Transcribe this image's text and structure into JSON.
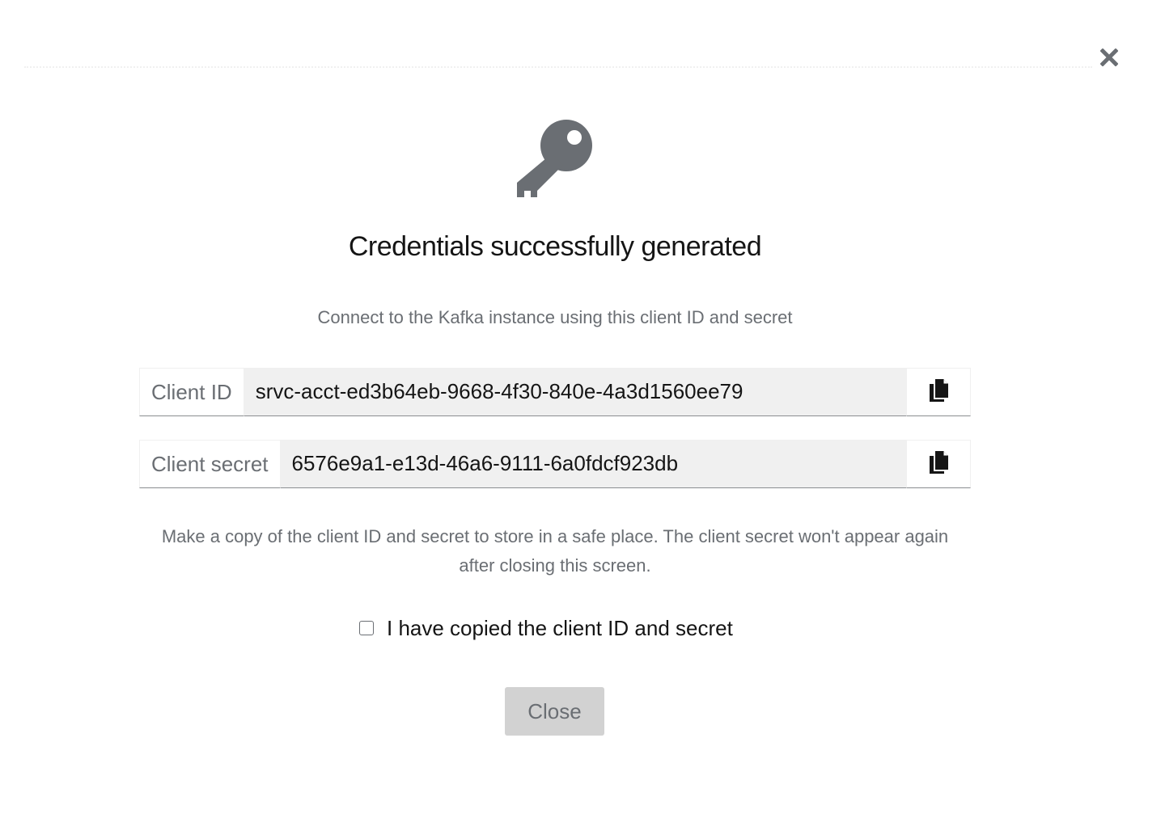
{
  "modal": {
    "title": "Credentials successfully generated",
    "subtitle": "Connect to the Kafka instance using this client ID and secret",
    "close_icon": "close-icon",
    "hero_icon": "key-icon"
  },
  "fields": [
    {
      "label": "Client ID",
      "value": "srvc-acct-ed3b64eb-9668-4f30-840e-4a3d1560ee79",
      "copy_icon": "copy-icon"
    },
    {
      "label": "Client secret",
      "value": "6576e9a1-e13d-46a6-9111-6a0fdcf923db",
      "copy_icon": "copy-icon"
    }
  ],
  "note": "Make a copy of the client ID and secret to store in a safe place. The client secret won't appear again after closing this screen.",
  "confirm": {
    "label": "I have copied the client ID and secret",
    "checked": false
  },
  "actions": {
    "close_label": "Close",
    "close_disabled": true
  },
  "colors": {
    "icon_gray": "#6a6e73",
    "field_bg": "#f0f0f0",
    "disabled_button_bg": "#d2d2d2"
  }
}
